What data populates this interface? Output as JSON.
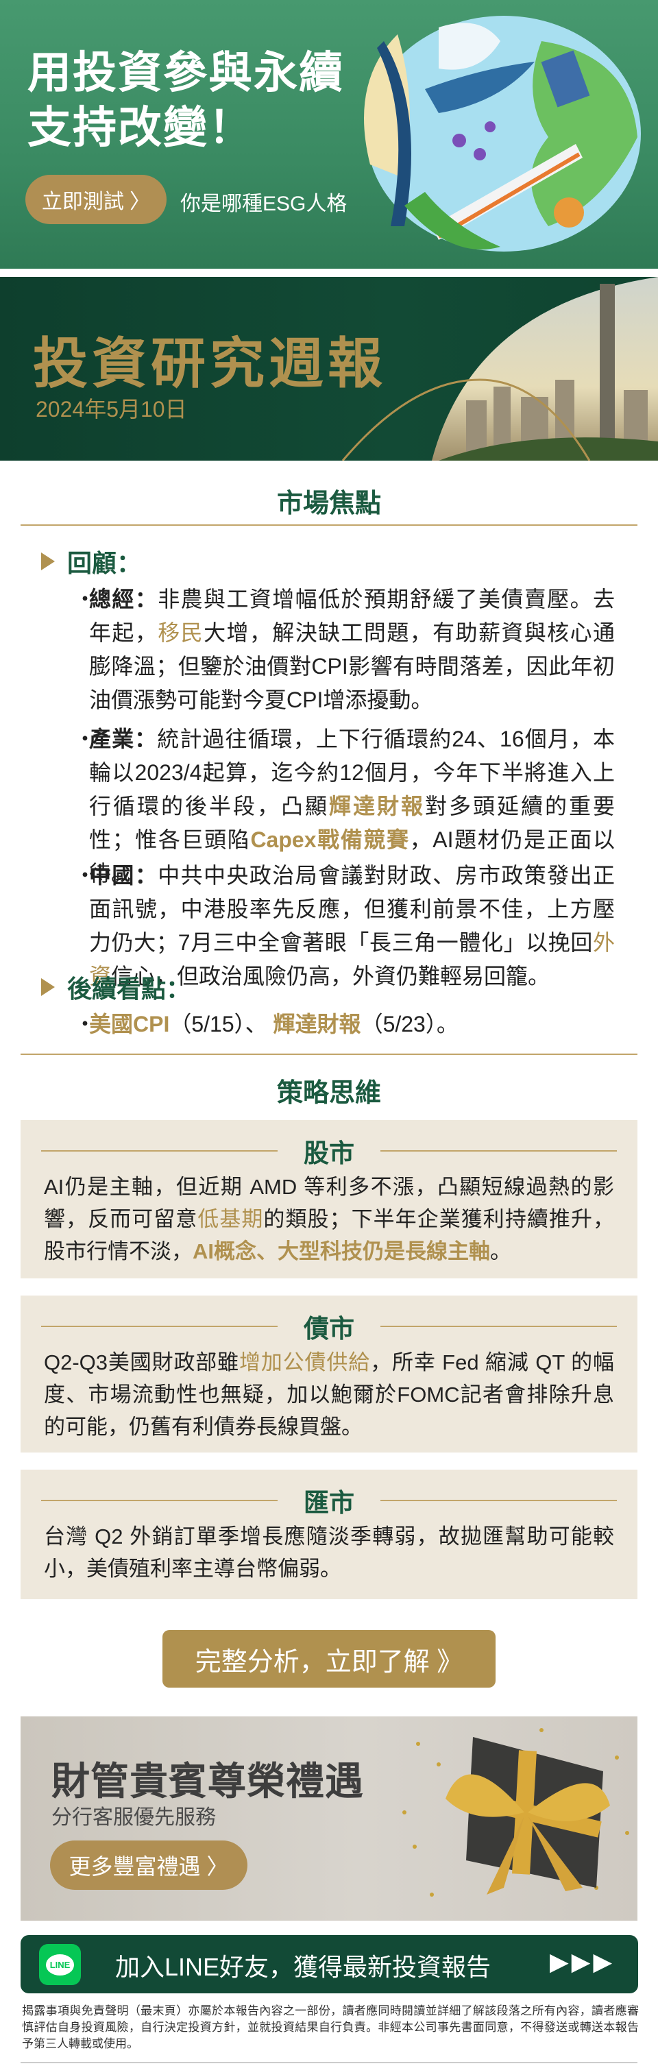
{
  "esg_banner": {
    "title_line1": "用投資參與永續",
    "title_line2": "支持改變！",
    "button_label": "立即測試 〉",
    "tagline": "你是哪種ESG人格"
  },
  "report_banner": {
    "title": "投資研究週報",
    "date": "2024年5月10日"
  },
  "market_focus": {
    "title": "市場焦點",
    "review_heading": "回顧：",
    "review_items": [
      {
        "label": "總經：",
        "segments": [
          {
            "text": "非農與工資增幅低於預期舒緩了美債賣壓。去年起，"
          },
          {
            "text": "移民",
            "hl": true
          },
          {
            "text": "大增，解決缺工問題，有助薪資與核心通膨降溫；但鑒於油價對CPI影響有時間落差，因此年初油價漲勢可能對今夏CPI增添擾動。"
          }
        ]
      },
      {
        "label": "產業：",
        "segments": [
          {
            "text": "統計過往循環，上下行循環約24、16個月，本輪以2023/4起算，迄今約12個月，今年下半將進入上行循環的後半段，凸顯"
          },
          {
            "text": "輝達財報",
            "hl": true,
            "bold": true
          },
          {
            "text": "對多頭延續的重要性；惟各巨頭陷"
          },
          {
            "text": "Capex戰備競賽",
            "hl": true,
            "bold": true
          },
          {
            "text": "，AI題材仍是正面以待。"
          }
        ]
      },
      {
        "label": "中國：",
        "segments": [
          {
            "text": "中共中央政治局會議對財政、房市政策發出正面訊號，中港股率先反應，但獲利前景不佳，上方壓力仍大；7月三中全會著眼「長三角一體化」以挽回"
          },
          {
            "text": "外資",
            "hl": true
          },
          {
            "text": "信心，但政治風險仍高，外資仍難輕易回籠。"
          }
        ]
      }
    ],
    "watch_heading": "後續看點：",
    "watch_items": [
      {
        "segments": [
          {
            "text": "美國CPI",
            "hl": true,
            "bold": true
          },
          {
            "text": "（5/15）、 "
          },
          {
            "text": "輝達財報",
            "hl": true,
            "bold": true
          },
          {
            "text": "（5/23）。"
          }
        ]
      }
    ]
  },
  "strategy": {
    "title": "策略思維",
    "boxes": [
      {
        "heading": "股市",
        "segments": [
          {
            "text": "AI仍是主軸，但近期 AMD 等利多不漲，凸顯短線過熱的影響，反而可留意"
          },
          {
            "text": "低基期",
            "hl": true
          },
          {
            "text": "的類股；下半年企業獲利持續推升，股市行情不淡，"
          },
          {
            "text": "AI概念、大型科技仍是長線主軸",
            "hl": true,
            "bold": true
          },
          {
            "text": "。"
          }
        ]
      },
      {
        "heading": "債市",
        "segments": [
          {
            "text": "Q2-Q3美國財政部雖"
          },
          {
            "text": "增加公債供給",
            "hl": true
          },
          {
            "text": "，所幸 Fed 縮減 QT 的幅度、市場流動性也無疑，加以鮑爾於FOMC記者會排除升息的可能，仍舊有利債券長線買盤。"
          }
        ]
      },
      {
        "heading": "匯市",
        "segments": [
          {
            "text": "台灣 Q2 外銷訂單季增長應隨淡季轉弱，故拋匯幫助可能較小，美債殖利率主導台幣偏弱。"
          }
        ]
      }
    ]
  },
  "cta": {
    "label": "完整分析，立即了解 》"
  },
  "gift_banner": {
    "title": "財管貴賓尊榮禮遇",
    "subtitle": "分行客服優先服務",
    "button_label": "更多豐富禮遇 〉"
  },
  "line_bar": {
    "icon_text": "LINE",
    "label": "加入LINE好友，獲得最新投資報告",
    "arrows": "▶▶▶"
  },
  "disclaimer": "揭露事項與免責聲明（最末頁）亦屬於本報告內容之一部份，讀者應同時閱讀並詳細了解該段落之所有內容，讀者應審慎評估自身投資風險，自行決定投資方針，並就投資結果自行負責。非經本公司事先書面同意，不得發送或轉送本報告予第三人轉載或使用。",
  "colors": {
    "brand_green": "#124a36",
    "gold": "#b0914f",
    "box_bg": "#eee8dc",
    "line_green": "#06c755"
  }
}
